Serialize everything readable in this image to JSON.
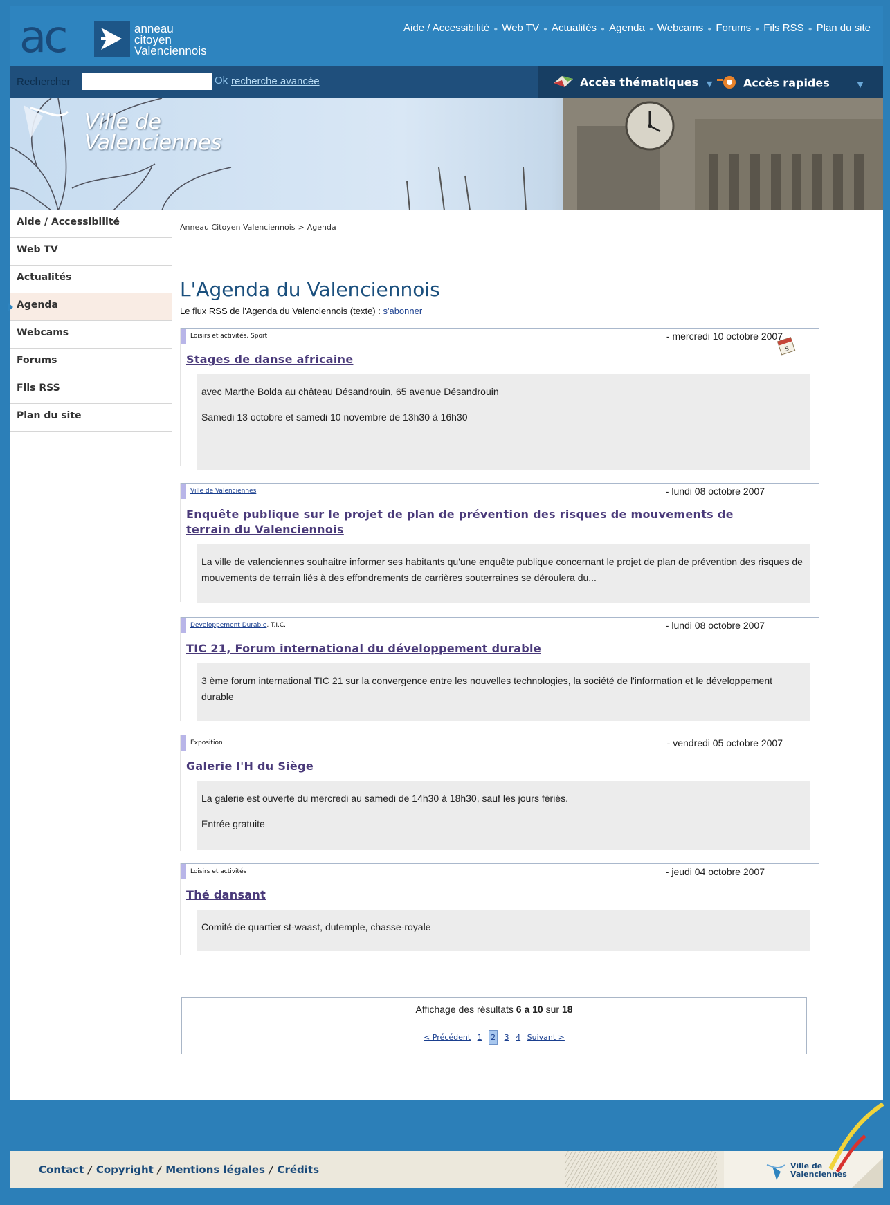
{
  "header": {
    "logo_letters": "ac",
    "brand_lines": [
      "anneau",
      "citoyen",
      "Valenciennois"
    ],
    "top_links": [
      "Aide / Accessibilité",
      "Web TV",
      "Actualités",
      "Agenda",
      "Webcams",
      "Forums",
      "Fils RSS",
      "Plan du site"
    ],
    "link_separator": "●"
  },
  "toolbar": {
    "search_label": "Rechercher",
    "search_value": "",
    "ok_label": "Ok",
    "advanced_label": "recherche avancée",
    "themes_label": "Accès thématiques",
    "quick_label": "Accès rapides",
    "caret": "▼"
  },
  "banner": {
    "ville_line1": "Ville de",
    "ville_line2": "Valenciennes"
  },
  "sidebar": {
    "items": [
      {
        "label": "Aide / Accessibilité"
      },
      {
        "label": "Web TV"
      },
      {
        "label": "Actualités"
      },
      {
        "label": "Agenda",
        "active": true
      },
      {
        "label": "Webcams"
      },
      {
        "label": "Forums"
      },
      {
        "label": "Fils RSS"
      },
      {
        "label": "Plan du site"
      }
    ]
  },
  "breadcrumb": {
    "home": "Anneau Citoyen Valenciennois",
    "sep": ">",
    "current": "Agenda"
  },
  "page": {
    "title": "L'Agenda du Valenciennois",
    "rss_text": "Le flux RSS de l'Agenda du Valenciennois (texte) : ",
    "rss_link": "s'abonner"
  },
  "events": [
    {
      "cats_plain": "Loisirs et activités, Sport",
      "cats_link": "",
      "cats_suffix": "",
      "date": "- mercredi 10 octobre 2007",
      "title": "Stages de danse africaine",
      "lines": [
        "avec Marthe Bolda au château Désandrouin, 65 avenue Désandrouin",
        "Samedi 13 octobre et samedi 10 novembre de 13h30 à 16h30"
      ]
    },
    {
      "cats_plain": "",
      "cats_link": "Ville de Valenciennes",
      "cats_suffix": "",
      "date": "- lundi 08 octobre 2007",
      "title": "Enquête publique sur le projet de plan de prévention des risques de mouvements de terrain du Valenciennois",
      "lines": [
        "La ville de valenciennes souhaitre informer ses habitants qu'une enquête publique concernant le projet de plan de prévention des risques de mouvements de terrain liés à des effondrements de carrières souterraines se déroulera du..."
      ]
    },
    {
      "cats_plain": "",
      "cats_link": "Developpement Durable",
      "cats_suffix": ", T.I.C.",
      "date": "- lundi 08 octobre 2007",
      "title": "TIC 21, Forum international du développement durable",
      "lines": [
        "3 ème forum international TIC 21 sur la convergence entre les nouvelles technologies, la société de l'information et le développement durable"
      ]
    },
    {
      "cats_plain": "Exposition",
      "cats_link": "",
      "cats_suffix": "",
      "date": "- vendredi 05 octobre 2007",
      "title": "Galerie l'H du Siège",
      "lines": [
        "La galerie est ouverte du mercredi au samedi de 14h30 à 18h30, sauf les jours fériés.",
        "Entrée gratuite"
      ]
    },
    {
      "cats_plain": "Loisirs et activités",
      "cats_link": "",
      "cats_suffix": "",
      "date": "- jeudi 04 octobre 2007",
      "title": "Thé dansant",
      "lines": [
        "Comité de quartier st-waast, dutemple, chasse-royale"
      ]
    }
  ],
  "pager": {
    "summary_prefix": "Affichage des résultats ",
    "range": "6 a 10",
    "summary_mid": " sur ",
    "total": "18",
    "prev": "< Précédent",
    "pages": [
      "1",
      "2",
      "3",
      "4"
    ],
    "current_page": "2",
    "next": "Suivant >"
  },
  "footer": {
    "links": [
      "Contact",
      "Copyright",
      "Mentions légales",
      "Crédits"
    ],
    "sep": "/",
    "logo_line1": "Ville de",
    "logo_line2": "Valenciennes"
  },
  "colors": {
    "background": "#2c7fb8",
    "header": "#2e84bf",
    "toolbar": "#1f4f7c",
    "title": "#1a4f7d",
    "event_title": "#4a3a7a",
    "event_body_bg": "#ececec",
    "category_bar": "#b8b5e8"
  }
}
